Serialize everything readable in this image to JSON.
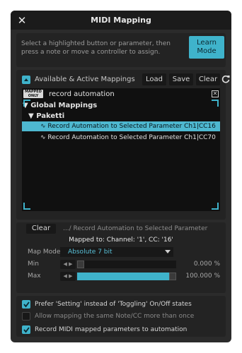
{
  "window": {
    "title": "MIDI Mapping",
    "close_label": "✕"
  },
  "learn": {
    "hint": "Select a highlighted button or parameter, then press a note or move a controller to assign.",
    "button_line1": "Learn",
    "button_line2": "Mode"
  },
  "mappings": {
    "section_title": "Available & Active Mappings",
    "load_label": "Load",
    "save_label": "Save",
    "clear_label": "Clear",
    "refresh_icon": "refresh-icon",
    "badge_line1": "MAPPED",
    "badge_line2": "ONLY",
    "search_value": "record automation",
    "tree": {
      "root": "Global Mappings",
      "group": "Paketti",
      "items": [
        "Record Automation to Selected Parameter Ch1|CC16",
        "Record Automation to Selected Parameter Ch1|CC70"
      ],
      "selected_index": 0
    }
  },
  "mapping_detail": {
    "clear_label": "Clear",
    "target": ".../ Record Automation to Selected Parameter",
    "mapped_to": "Mapped to: Channel: '1', CC: '16'",
    "map_mode_label": "Map Mode",
    "map_mode_value": "Absolute 7 bit",
    "min_label": "Min",
    "min_value": "0.000 %",
    "min_fraction": 0.0,
    "max_label": "Max",
    "max_value": "100.000 %",
    "max_fraction": 1.0
  },
  "options": [
    {
      "label": "Prefer 'Setting' instead of 'Toggling' On/Off states",
      "checked": true
    },
    {
      "label": "Allow mapping the same Note/CC more than once",
      "checked": false
    },
    {
      "label": "Record MIDI mapped parameters to automation",
      "checked": true
    }
  ],
  "colors": {
    "accent": "#3fb3cb",
    "selection": "#4eb8d0",
    "background": "#2b2b2b",
    "panel": "#232323"
  }
}
